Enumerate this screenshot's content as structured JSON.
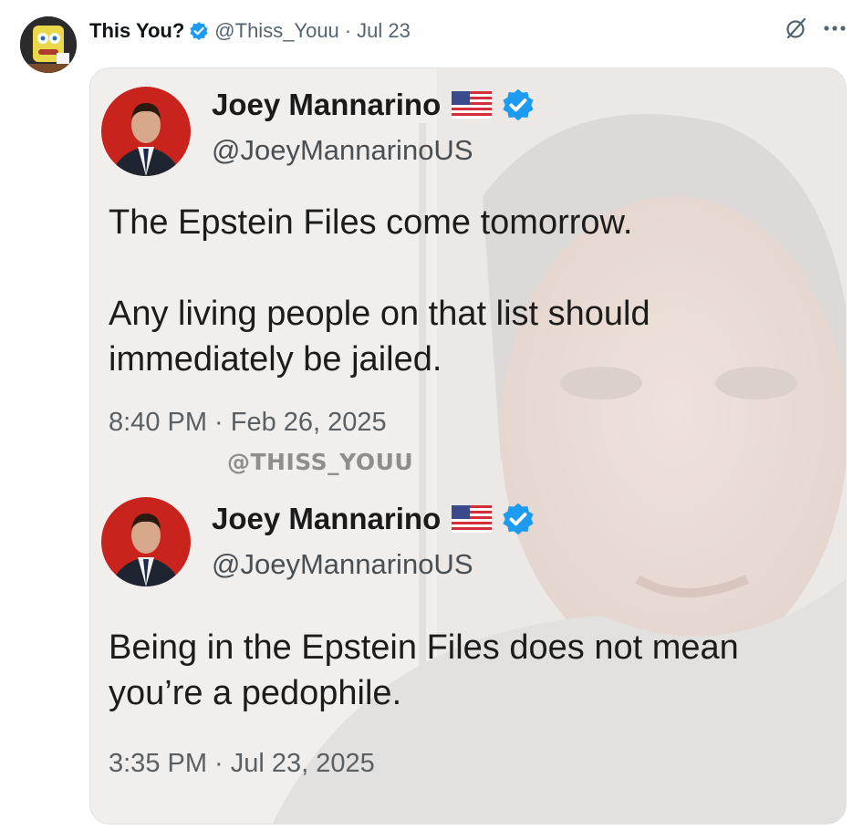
{
  "post": {
    "author_name": "This You?",
    "author_handle": "@Thiss_Youu",
    "separator": "·",
    "date": "Jul 23"
  },
  "icons": {
    "verified": "verified-badge-icon",
    "grok": "grok-icon",
    "more": "more-icon"
  },
  "colors": {
    "verified_blue": "#1d9bf0",
    "avatar_red": "#c8231c"
  },
  "media": {
    "watermark": "@THISS_YOUU",
    "tweets": [
      {
        "name": "Joey Mannarino",
        "handle": "@JoeyMannarinoUS",
        "text": "The Epstein Files come tomorrow.\n\nAny living people on that list should immediately be jailed.",
        "timestamp": "8:40 PM · Feb 26, 2025"
      },
      {
        "name": "Joey Mannarino",
        "handle": "@JoeyMannarinoUS",
        "text": "Being in the Epstein Files does not mean you’re a pedophile.",
        "timestamp": "3:35 PM · Jul 23, 2025"
      }
    ]
  }
}
